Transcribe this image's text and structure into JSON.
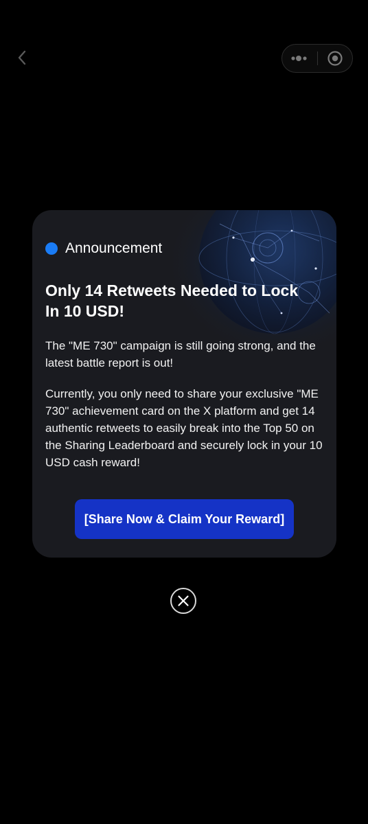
{
  "nav": {
    "back_icon": "chevron-left-icon",
    "more_icon": "more-dots-icon",
    "capsule_close_icon": "target-circle-icon"
  },
  "modal": {
    "tag_label": "Announcement",
    "tag_dot_color": "#1a7cf5",
    "title_line1": "Only 14 Retweets Needed to Lock",
    "title_line2": "In 10 USD!",
    "paragraph1": "The \"ME 730\" campaign is still going strong, and the latest battle report is out!",
    "paragraph2": "Currently, you only need to share your exclusive \"ME 730\" achievement card on the X platform and get 14 authentic retweets to easily break into the Top 50 on the Sharing Leaderboard and securely lock in your 10 USD cash reward!",
    "cta_label": "[Share Now & Claim Your Reward]",
    "cta_color": "#1533c6",
    "background_art": "globe-network-image"
  },
  "dismiss": {
    "icon": "close-icon"
  }
}
